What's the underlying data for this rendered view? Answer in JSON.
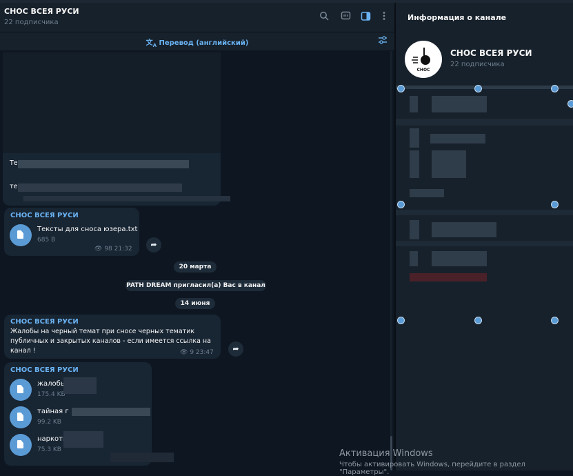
{
  "header": {
    "title": "СНОС ВСЕЯ РУСИ",
    "subtitle": "22 подписчика"
  },
  "translate_bar": {
    "label": "Перевод (английский)"
  },
  "messages": {
    "m1_text_a": "Те",
    "m1_text_b": "те",
    "m2": {
      "sender": "СНОС ВСЕЯ РУСИ",
      "file": "Тексты для сноса юзера.txt",
      "size": "685 B",
      "views": "98",
      "time": "21:32"
    },
    "date1": "20 марта",
    "service": "PATH DREAM пригласил(а) Вас в канал",
    "date2": "14 июня",
    "m3": {
      "sender": "СНОС ВСЕЯ РУСИ",
      "text_lines": [
        "Жалобы на черный темат при сносе черных тематик",
        "публичных и закрытых каналов - если имеется ссылка на",
        "канал !"
      ],
      "views": "9",
      "time": "23:47"
    },
    "m4": {
      "sender": "СНОС ВСЕЯ РУСИ",
      "files": [
        {
          "name": "жалобы",
          "size": "175.4 KB"
        },
        {
          "name": "тайная г",
          "size": "99.2 KB"
        },
        {
          "name": "наркоти",
          "size": "75.3 KB"
        }
      ]
    }
  },
  "panel": {
    "title": "Информация о канале",
    "name": "СНОС ВСЕЯ РУСИ",
    "subtitle": "22 подписчика",
    "avatar_text": "СНОС"
  },
  "watermark": {
    "line1": "Активация Windows",
    "line2": "Чтобы активировать Windows, перейдите в раздел \"Параметры\"."
  },
  "colors": {
    "accent": "#6ab3f3",
    "background": "#0e1621",
    "bubble": "#182533",
    "panel": "#17212b"
  }
}
